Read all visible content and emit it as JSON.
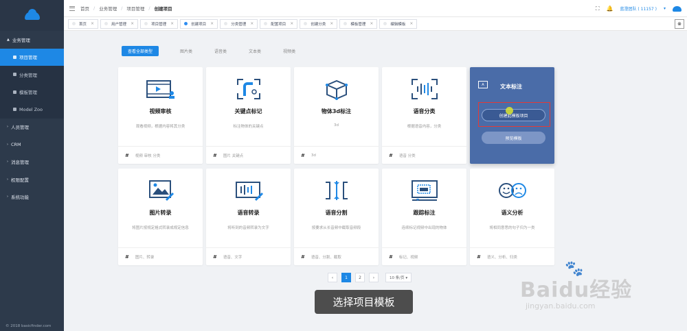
{
  "sidebar": {
    "menu": [
      {
        "label": "业务管理",
        "type": "group",
        "expanded": true
      },
      {
        "label": "项目管理",
        "type": "sub",
        "active": true
      },
      {
        "label": "分类管理",
        "type": "sub"
      },
      {
        "label": "模板管理",
        "type": "sub"
      },
      {
        "label": "Model Zoo",
        "type": "sub"
      },
      {
        "label": "人员管理",
        "type": "group"
      },
      {
        "label": "CRM",
        "type": "group"
      },
      {
        "label": "消息管理",
        "type": "group"
      },
      {
        "label": "权限配置",
        "type": "group"
      },
      {
        "label": "系统功能",
        "type": "group"
      }
    ],
    "copyright": "© 2018 basicfinder.com"
  },
  "header": {
    "breadcrumbs": [
      "首页",
      "业务管理",
      "项目管理",
      "创建项目"
    ],
    "user": "蓝澄团队 ( 11157 )"
  },
  "tabs": [
    "首页",
    "用户管理",
    "项目管理",
    "创建项目",
    "分类管理",
    "配置项目",
    "创建分类",
    "模板管理",
    "编辑模板"
  ],
  "active_tab": 3,
  "filters": [
    "查看全部类型",
    "图片类",
    "语音类",
    "文本类",
    "视频类"
  ],
  "cards": [
    {
      "name": "视频审核",
      "desc": "观看视频，根据内容将其分类",
      "tags": "视频 审核 分类",
      "icon": "video-icon"
    },
    {
      "name": "关键点标记",
      "desc": "标注物体的关键点",
      "tags": "图片 关键点",
      "icon": "keypoint-icon"
    },
    {
      "name": "物体3d标注",
      "desc": "3d",
      "tags": "3d",
      "icon": "cube-3d-icon"
    },
    {
      "name": "语音分类",
      "desc": "根据语音内容，分类",
      "tags": "语音 分类",
      "icon": "audio-classify-icon"
    },
    {
      "name": "文本标注",
      "hover": true,
      "create_label": "创建此模板项目",
      "preview_label": "预览模板",
      "icon": "text-label-icon"
    },
    {
      "name": "图片转录",
      "desc": "将图片按规定格式转录成规定信息",
      "tags": "图片、转录",
      "icon": "image-transcribe-icon"
    },
    {
      "name": "语音转录",
      "desc": "将听到的音频转录为文字",
      "tags": "语音、文字",
      "icon": "audio-transcribe-icon"
    },
    {
      "name": "语音分割",
      "desc": "按要求从长音频中截取音频段",
      "tags": "语音、分割、截取",
      "icon": "audio-split-icon"
    },
    {
      "name": "跟踪标注",
      "desc": "连续标记视频中出现的物体",
      "tags": "标记、视频",
      "icon": "tracking-icon"
    },
    {
      "name": "语义分析",
      "desc": "将相同意思的句子归为一类",
      "tags": "语义、分析、归类",
      "icon": "emotion-icon"
    }
  ],
  "pagination": {
    "pages": [
      "1",
      "2"
    ],
    "current": "1",
    "prev": "‹",
    "next": "›",
    "page_size": "10 条/页 ▾"
  },
  "caption": "选择项目模板",
  "watermark": {
    "brand": "Baidu经验",
    "url": "jingyan.baidu.com"
  },
  "colors": {
    "primary": "#1e88e5",
    "sidebar": "#2d3a4b",
    "hover_card": "#4a6ca8",
    "highlight": "#e53935",
    "icon": "#2a4f7c"
  }
}
